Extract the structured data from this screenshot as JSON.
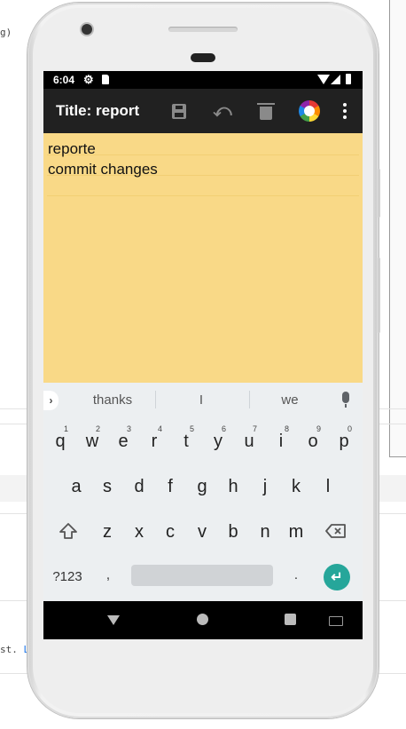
{
  "background": {
    "code_fragment": "g)",
    "link_fragment_prefix": "st.",
    "link_fragment": "Lea"
  },
  "status_bar": {
    "time": "6:04",
    "icons": [
      "gear-icon",
      "sd-card-icon",
      "wifi-icon",
      "signal-icon",
      "battery-icon"
    ]
  },
  "toolbar": {
    "title": "Title: report",
    "actions": [
      "save-icon",
      "undo-icon",
      "delete-icon",
      "color-picker-icon",
      "overflow-menu-icon"
    ]
  },
  "note": {
    "lines": [
      "reporte",
      "commit changes"
    ],
    "background_color": "#f9d987"
  },
  "keyboard": {
    "suggestions": [
      "thanks",
      "I",
      "we"
    ],
    "row1": [
      "q",
      "w",
      "e",
      "r",
      "t",
      "y",
      "u",
      "i",
      "o",
      "p"
    ],
    "row1_numbers": [
      "1",
      "2",
      "3",
      "4",
      "5",
      "6",
      "7",
      "8",
      "9",
      "0"
    ],
    "row2": [
      "a",
      "s",
      "d",
      "f",
      "g",
      "h",
      "j",
      "k",
      "l"
    ],
    "row3": [
      "z",
      "x",
      "c",
      "v",
      "b",
      "n",
      "m"
    ],
    "symbols_key": "?123",
    "comma_key": ",",
    "period_key": ".",
    "enter_color": "#26a69a"
  },
  "nav_bar": {
    "buttons": [
      "back-icon",
      "home-icon",
      "recents-icon",
      "keyboard-switch-icon"
    ]
  }
}
